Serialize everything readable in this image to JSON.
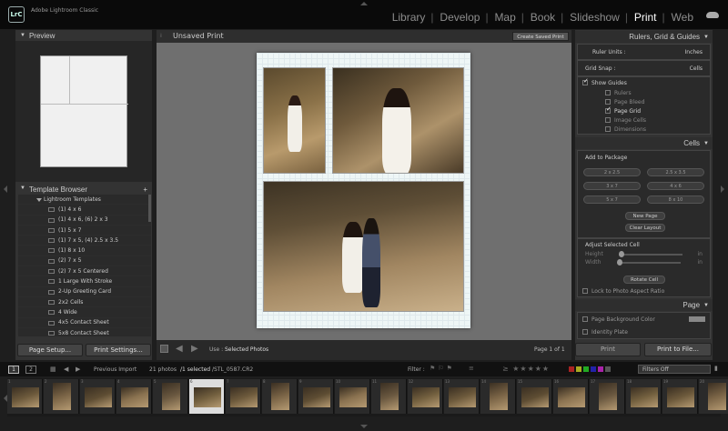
{
  "app": {
    "logo": "LrC",
    "name": "Adobe Lightroom Classic"
  },
  "modules": [
    "Library",
    "Develop",
    "Map",
    "Book",
    "Slideshow",
    "Print",
    "Web"
  ],
  "active_module": "Print",
  "left": {
    "preview_title": "Preview",
    "template_browser_title": "Template Browser",
    "template_browser_add": "+",
    "templates_root": "Lightroom Templates",
    "templates": [
      "(1) 4 x 6",
      "(1) 4 x 6, (6) 2 x 3",
      "(1) 5 x 7",
      "(1) 7 x 5, (4) 2.5 x 3.5",
      "(1) 8 x 10",
      "(2) 7 x 5",
      "(2) 7 x 5 Centered",
      "1 Large With Stroke",
      "2-Up Greeting Card",
      "2x2 Cells",
      "4 Wide",
      "4x5 Contact Sheet",
      "5x8 Contact Sheet"
    ],
    "page_setup": "Page Setup...",
    "print_settings": "Print Settings..."
  },
  "center": {
    "title": "Unsaved Print",
    "create_saved_print": "Create Saved Print",
    "use_label": "Use :",
    "use_value": "Selected Photos",
    "page_indicator": "Page 1 of 1"
  },
  "right": {
    "rulers_title": "Rulers, Grid & Guides",
    "ruler_units_label": "Ruler Units :",
    "ruler_units_value": "Inches",
    "grid_snap_label": "Grid Snap :",
    "grid_snap_value": "Cells",
    "show_guides": "Show Guides",
    "guides": [
      {
        "label": "Rulers",
        "checked": false
      },
      {
        "label": "Page Bleed",
        "checked": false
      },
      {
        "label": "Page Grid",
        "checked": true
      },
      {
        "label": "Image Cells",
        "checked": false
      },
      {
        "label": "Dimensions",
        "checked": false
      }
    ],
    "cells_title": "Cells",
    "add_to_package": "Add to Package",
    "cell_sizes": [
      "2 x 2.5",
      "2.5 x 3.5",
      "3 x 7",
      "4 x 6",
      "5 x 7",
      "8 x 10"
    ],
    "new_page": "New Page",
    "clear_layout": "Clear Layout",
    "adjust_selected_cell": "Adjust Selected Cell",
    "height_label": "Height",
    "height_unit": "in",
    "width_label": "Width",
    "width_unit": "in",
    "rotate_cell": "Rotate Cell",
    "lock_aspect": "Lock to Photo Aspect Ratio",
    "page_title": "Page",
    "page_bg_color": "Page Background Color",
    "identity_plate": "Identity Plate",
    "print": "Print",
    "print_to_file": "Print to File..."
  },
  "filmstrip": {
    "view1": "1",
    "view2": "2",
    "source": "Previous Import",
    "count": "21 photos",
    "selected": "/1 selected",
    "filename": "/STL_0587.CR2",
    "filter_label": "Filter :",
    "filters_off": "Filters Off",
    "selected_index": 5
  }
}
